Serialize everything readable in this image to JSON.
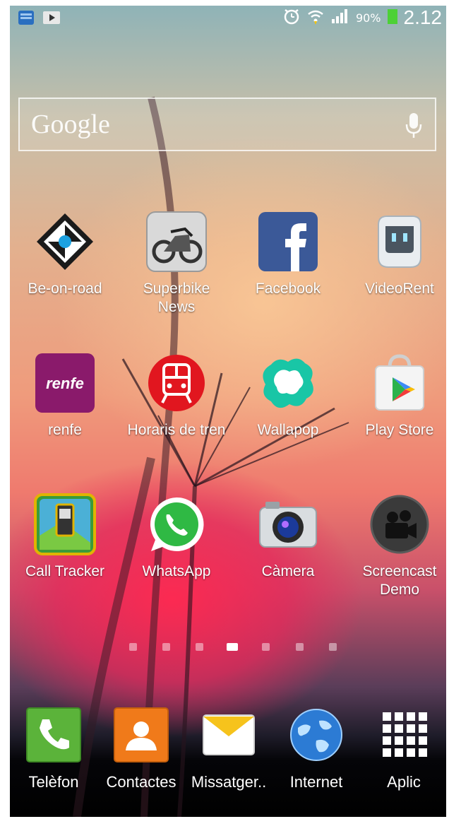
{
  "status_bar": {
    "left_icons": [
      "messenger-app-icon",
      "media-play-icon"
    ],
    "right_icons": [
      "alarm-icon",
      "wifi-icon",
      "signal-icon"
    ],
    "battery_percent": "90%",
    "battery_icon": "battery-icon",
    "time": "2.12"
  },
  "search": {
    "label": "Google",
    "mic_icon": "microphone-icon"
  },
  "apps": [
    {
      "label": "Be-on-road",
      "icon": "beonroad-icon"
    },
    {
      "label": "Superbike News",
      "icon": "superbike-icon"
    },
    {
      "label": "Facebook",
      "icon": "facebook-icon"
    },
    {
      "label": "VideoRent",
      "icon": "videorent-icon"
    },
    {
      "label": "renfe",
      "icon": "renfe-icon",
      "icon_text": "renfe"
    },
    {
      "label": "Horaris de tren",
      "icon": "train-icon"
    },
    {
      "label": "Wallapop",
      "icon": "wallapop-icon"
    },
    {
      "label": "Play Store",
      "icon": "play-store-icon"
    },
    {
      "label": "Call Tracker",
      "icon": "call-tracker-icon"
    },
    {
      "label": "WhatsApp",
      "icon": "whatsapp-icon"
    },
    {
      "label": "Càmera",
      "icon": "camera-icon"
    },
    {
      "label": "Screencast Demo",
      "icon": "screencast-icon"
    }
  ],
  "page_indicator": {
    "count": 7,
    "active_index": 3
  },
  "dock": [
    {
      "label": "Telèfon",
      "icon": "phone-icon"
    },
    {
      "label": "Contactes",
      "icon": "contacts-icon"
    },
    {
      "label": "Missatger..",
      "icon": "messages-icon"
    },
    {
      "label": "Internet",
      "icon": "globe-icon"
    },
    {
      "label": "Aplic",
      "icon": "apps-grid-icon"
    }
  ],
  "colors": {
    "facebook": "#3b5998",
    "renfe": "#8a1a6b",
    "train_red": "#e1161f",
    "whatsapp": "#2fb944",
    "wallapop": "#19c6a6",
    "phone": "#5bb33a",
    "contacts": "#f07a1a",
    "messages": "#f6c31c",
    "globe": "#2c7bd4"
  }
}
